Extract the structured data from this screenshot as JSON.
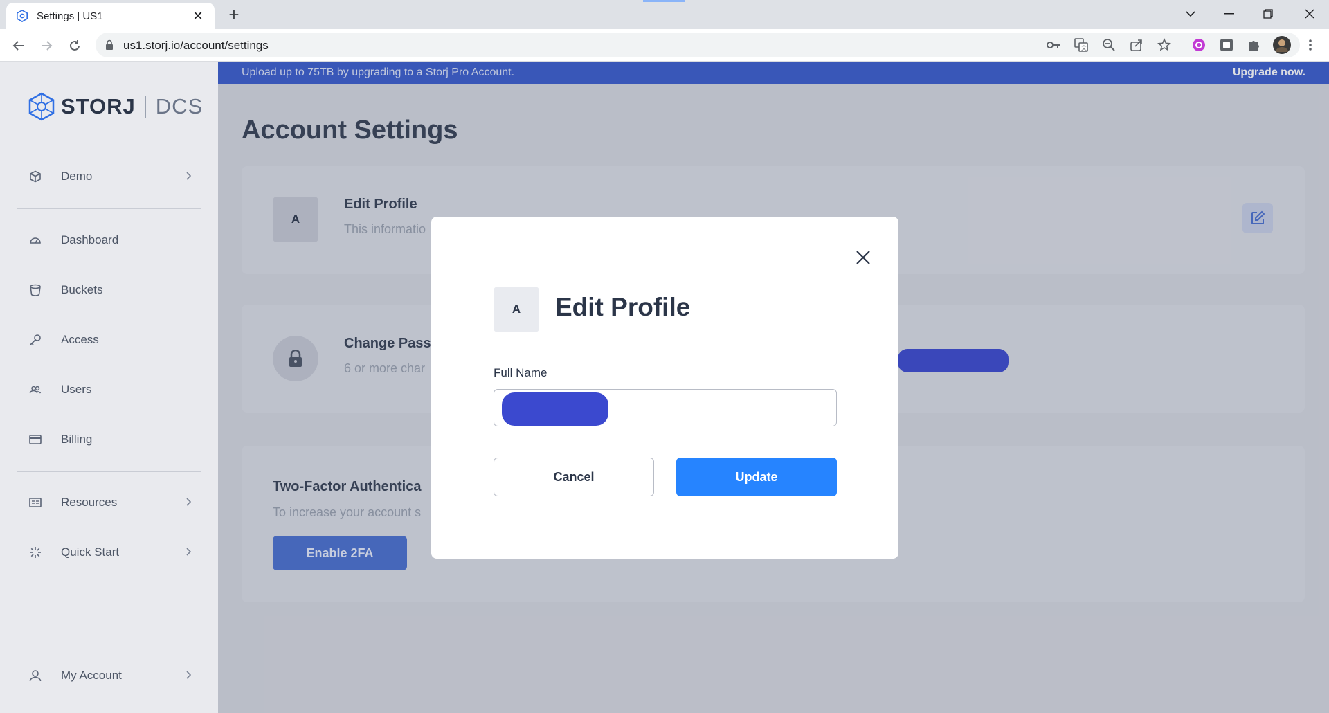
{
  "browser": {
    "tab_title": "Settings | US1",
    "tab_close": "✕",
    "new_tab": "+",
    "url": "us1.storj.io/account/settings"
  },
  "sidebar": {
    "brand": "STORJ",
    "product": "DCS",
    "project": {
      "label": "Demo"
    },
    "items": [
      {
        "label": "Dashboard",
        "icon": "dashboard-icon"
      },
      {
        "label": "Buckets",
        "icon": "bucket-icon"
      },
      {
        "label": "Access",
        "icon": "key-icon"
      },
      {
        "label": "Users",
        "icon": "users-icon"
      },
      {
        "label": "Billing",
        "icon": "card-icon"
      }
    ],
    "resources": {
      "label": "Resources"
    },
    "quick_start": {
      "label": "Quick Start"
    },
    "my_account": {
      "label": "My Account"
    }
  },
  "banner": {
    "text": "Upload up to 75TB by upgrading to a Storj Pro Account.",
    "link": "Upgrade now."
  },
  "page": {
    "title": "Account Settings",
    "edit_profile": {
      "avatar_letter": "A",
      "title": "Edit Profile",
      "subtitle": "This informatio"
    },
    "change_password": {
      "title": "Change Pass",
      "subtitle": "6 or more char"
    },
    "two_factor": {
      "title": "Two-Factor Authentica",
      "subtitle": "To increase your account s",
      "button": "Enable 2FA"
    }
  },
  "modal": {
    "avatar_letter": "A",
    "title": "Edit Profile",
    "field_label": "Full Name",
    "cancel": "Cancel",
    "update": "Update"
  },
  "colors": {
    "banner": "#3a5ccc",
    "primary": "#2684ff",
    "redaction": "#3b49cf"
  }
}
